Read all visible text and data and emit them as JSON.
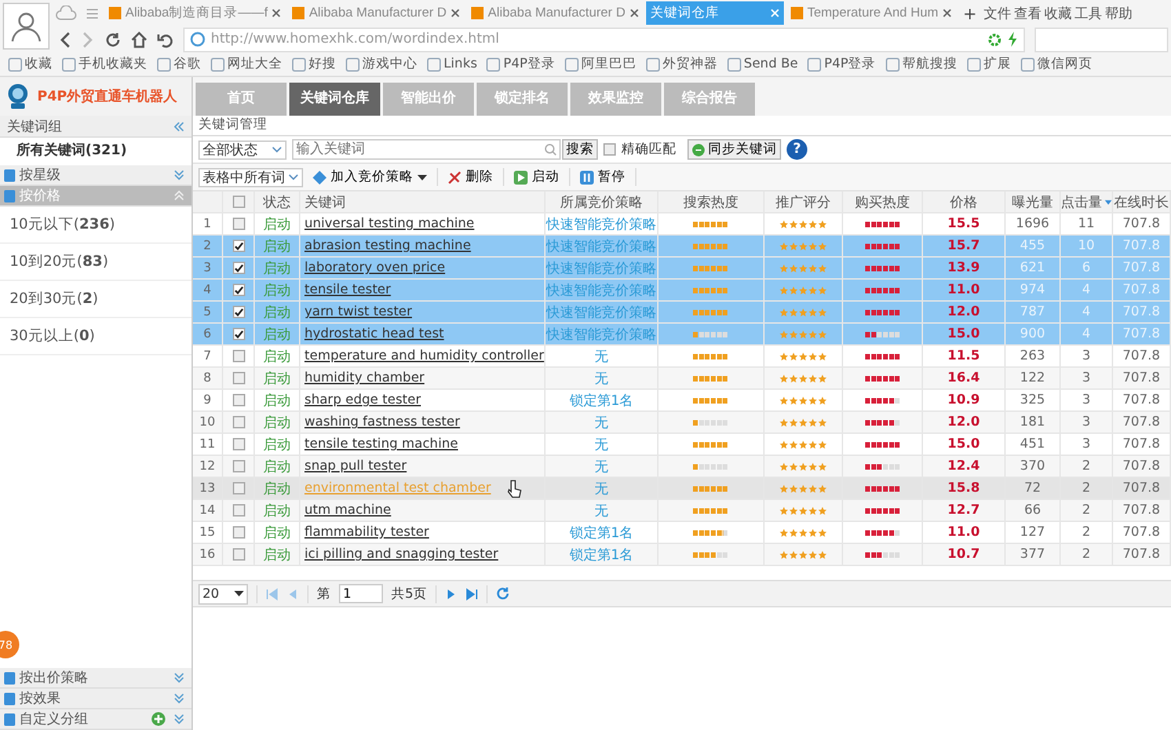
{
  "browser": {
    "tabs": [
      {
        "label": "Alibaba制造商目录——f",
        "selected": false
      },
      {
        "label": "Alibaba Manufacturer D",
        "selected": false
      },
      {
        "label": "Alibaba Manufacturer D",
        "selected": false
      },
      {
        "label": "关键词仓库",
        "selected": true
      },
      {
        "label": "Temperature And Hum",
        "selected": false
      }
    ],
    "new_tab": "+",
    "menu": [
      "文件",
      "查看",
      "收藏",
      "工具",
      "帮助"
    ],
    "address": "http://www.homexhk.com/wordindex.html",
    "bookmarks": [
      "收藏",
      "手机收藏夹",
      "谷歌",
      "网址大全",
      "好搜",
      "游戏中心",
      "Links",
      "P4P登录",
      "阿里巴巴",
      "外贸神器",
      "Send Be",
      "P4P登录",
      "帮航搜搜",
      "扩展",
      "微信网页"
    ]
  },
  "app": {
    "logo": "P4P外贸直通车机器人",
    "nav_tabs": [
      {
        "label": "首页",
        "selected": false
      },
      {
        "label": "关键词仓库",
        "selected": true
      },
      {
        "label": "智能出价",
        "selected": false
      },
      {
        "label": "锁定排名",
        "selected": false
      },
      {
        "label": "效果监控",
        "selected": false
      },
      {
        "label": "综合报告",
        "selected": false
      }
    ],
    "sidebar": {
      "title": "关键词组",
      "all": "所有关键词(321)",
      "groups": [
        {
          "label": "按星级",
          "expanded": false
        },
        {
          "label": "按价格",
          "expanded": true,
          "items": [
            "10元以下(**236**)",
            "10到20元(**83**)",
            "20到30元(**2**)",
            "30元以上(**0**)"
          ]
        }
      ],
      "bottom_groups": [
        {
          "label": "按出价策略",
          "expanded": false,
          "addable": false
        },
        {
          "label": "按效果",
          "expanded": false,
          "addable": false
        },
        {
          "label": "自定义分组",
          "expanded": false,
          "addable": true
        }
      ],
      "badge": "78"
    },
    "panel_title": "关键词管理",
    "filter": {
      "status": "全部状态",
      "placeholder": "输入关键词",
      "search": "搜索",
      "exact_match": {
        "label": "精确匹配",
        "checked": false
      },
      "sync": "同步关键词",
      "help": "?"
    },
    "toolbar": {
      "scope": "表格中所有词",
      "add_strategy": "加入竞价策略",
      "delete": "删除",
      "start": "启动",
      "pause": "暂停"
    },
    "select_all": {
      "checked": false
    },
    "columns": [
      "状态",
      "关键词",
      "所属竞价策略",
      "搜索热度",
      "推广评分",
      "购买热度",
      "价格",
      "曝光量",
      "点击量",
      "在线时长"
    ],
    "rows": [
      {
        "num": "1",
        "checked": false,
        "hovered": false,
        "status": "启动",
        "keyword": "universal testing machine",
        "strategy": "快速智能竞价策略",
        "search_heat": {
          "level": 1
        },
        "stars": 5,
        "buy_heat": {
          "level": 1
        },
        "price": "15.5",
        "impressions": "1696",
        "clicks": "11",
        "online": "707.8"
      },
      {
        "num": "2",
        "checked": true,
        "hovered": false,
        "status": "启动",
        "keyword": "abrasion testing machine",
        "strategy": "快速智能竞价策略",
        "search_heat": {
          "level": 1
        },
        "stars": 5,
        "buy_heat": {
          "level": 1
        },
        "price": "15.7",
        "impressions": "455",
        "clicks": "10",
        "online": "707.8"
      },
      {
        "num": "3",
        "checked": true,
        "hovered": false,
        "status": "启动",
        "keyword": "laboratory oven price",
        "strategy": "快速智能竞价策略",
        "search_heat": {
          "level": 1
        },
        "stars": 5,
        "buy_heat": {
          "level": 1
        },
        "price": "13.9",
        "impressions": "621",
        "clicks": "6",
        "online": "707.8"
      },
      {
        "num": "4",
        "checked": true,
        "hovered": false,
        "status": "启动",
        "keyword": "tensile tester",
        "strategy": "快速智能竞价策略",
        "search_heat": {
          "level": 1
        },
        "stars": 5,
        "buy_heat": {
          "level": 1
        },
        "price": "11.0",
        "impressions": "974",
        "clicks": "4",
        "online": "707.8"
      },
      {
        "num": "5",
        "checked": true,
        "hovered": false,
        "status": "启动",
        "keyword": "yarn twist tester",
        "strategy": "快速智能竞价策略",
        "search_heat": {
          "level": 1
        },
        "stars": 5,
        "buy_heat": {
          "level": 1
        },
        "price": "12.0",
        "impressions": "787",
        "clicks": "4",
        "online": "707.8"
      },
      {
        "num": "6",
        "checked": true,
        "hovered": false,
        "status": "启动",
        "keyword": "hydrostatic head test",
        "strategy": "快速智能竞价策略",
        "search_heat": {
          "level": 0.17
        },
        "stars": 5,
        "buy_heat": {
          "level": 0.33
        },
        "price": "15.0",
        "impressions": "900",
        "clicks": "4",
        "online": "707.8"
      },
      {
        "num": "7",
        "checked": false,
        "hovered": false,
        "status": "启动",
        "keyword": "temperature and humidity controller",
        "strategy": "无",
        "search_heat": {
          "level": 1
        },
        "stars": 5,
        "buy_heat": {
          "level": 1
        },
        "price": "11.5",
        "impressions": "263",
        "clicks": "3",
        "online": "707.8"
      },
      {
        "num": "8",
        "checked": false,
        "hovered": false,
        "status": "启动",
        "keyword": "humidity chamber",
        "strategy": "无",
        "search_heat": {
          "level": 1
        },
        "stars": 5,
        "buy_heat": {
          "level": 1
        },
        "price": "16.4",
        "impressions": "122",
        "clicks": "3",
        "online": "707.8"
      },
      {
        "num": "9",
        "checked": false,
        "hovered": false,
        "status": "启动",
        "keyword": "sharp edge tester",
        "strategy": "锁定第1名",
        "search_heat": {
          "level": 1
        },
        "stars": 5,
        "buy_heat": {
          "level": 0.83
        },
        "price": "10.9",
        "impressions": "325",
        "clicks": "3",
        "online": "707.8"
      },
      {
        "num": "10",
        "checked": false,
        "hovered": false,
        "status": "启动",
        "keyword": "washing fastness tester",
        "strategy": "无",
        "search_heat": {
          "level": 0.17
        },
        "stars": 5,
        "buy_heat": {
          "level": 0.83
        },
        "price": "12.0",
        "impressions": "181",
        "clicks": "3",
        "online": "707.8"
      },
      {
        "num": "11",
        "checked": false,
        "hovered": false,
        "status": "启动",
        "keyword": "tensile testing machine",
        "strategy": "无",
        "search_heat": {
          "level": 1
        },
        "stars": 5,
        "buy_heat": {
          "level": 1
        },
        "price": "15.0",
        "impressions": "451",
        "clicks": "3",
        "online": "707.8"
      },
      {
        "num": "12",
        "checked": false,
        "hovered": false,
        "status": "启动",
        "keyword": "snap pull tester",
        "strategy": "无",
        "search_heat": {
          "level": 0.17
        },
        "stars": 5,
        "buy_heat": {
          "level": 0.5
        },
        "price": "12.4",
        "impressions": "370",
        "clicks": "2",
        "online": "707.8"
      },
      {
        "num": "13",
        "checked": false,
        "hovered": true,
        "status": "启动",
        "keyword": "environmental test chamber",
        "strategy": "无",
        "search_heat": {
          "level": 1
        },
        "stars": 5,
        "buy_heat": {
          "level": 1
        },
        "price": "15.8",
        "impressions": "72",
        "clicks": "2",
        "online": "707.8"
      },
      {
        "num": "14",
        "checked": false,
        "hovered": false,
        "status": "启动",
        "keyword": "utm machine",
        "strategy": "无",
        "search_heat": {
          "level": 1
        },
        "stars": 5,
        "buy_heat": {
          "level": 1
        },
        "price": "12.7",
        "impressions": "66",
        "clicks": "2",
        "online": "707.8"
      },
      {
        "num": "15",
        "checked": false,
        "hovered": false,
        "status": "启动",
        "keyword": "flammability tester",
        "strategy": "锁定第1名",
        "search_heat": {
          "level": 0.83
        },
        "stars": 5,
        "buy_heat": {
          "level": 0.83
        },
        "price": "11.0",
        "impressions": "127",
        "clicks": "2",
        "online": "707.8"
      },
      {
        "num": "16",
        "checked": false,
        "hovered": false,
        "status": "启动",
        "keyword": "ici pilling and snagging tester",
        "strategy": "锁定第1名",
        "search_heat": {
          "level": 0.67
        },
        "stars": 5,
        "buy_heat": {
          "level": 0.5
        },
        "price": "10.7",
        "impressions": "377",
        "clicks": "2",
        "online": "707.8"
      }
    ],
    "pager": {
      "page_size": "20",
      "page_prefix": "第",
      "page": "1",
      "total": "共5页"
    }
  }
}
